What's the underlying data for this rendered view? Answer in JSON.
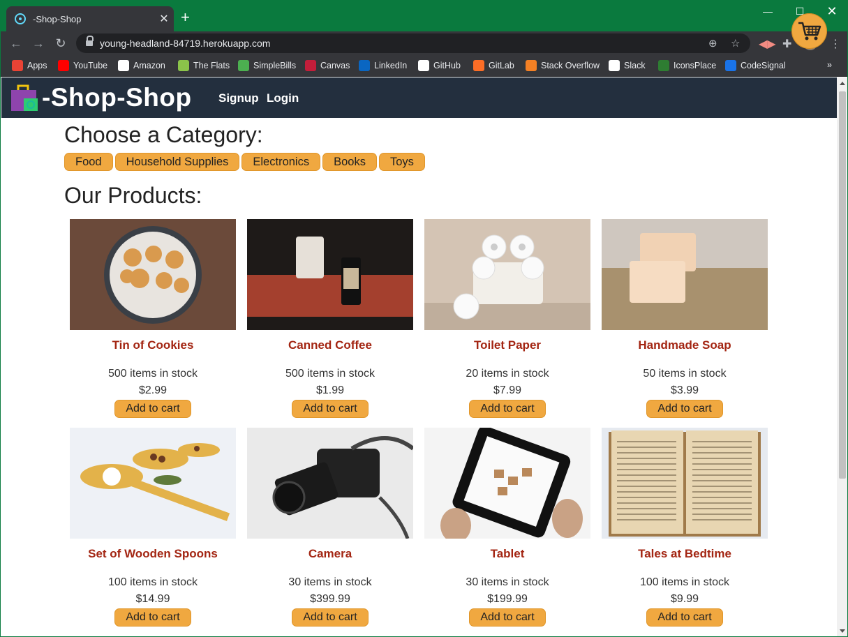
{
  "browser": {
    "tab_title": "-Shop-Shop",
    "url": "young-headland-84719.herokuapp.com",
    "bookmarks": [
      {
        "label": "Apps",
        "icon": "apps-grid-icon",
        "color": "#ea4335"
      },
      {
        "label": "YouTube",
        "icon": "youtube-icon",
        "color": "#ff0000"
      },
      {
        "label": "Amazon",
        "icon": "amazon-icon",
        "color": "#ffffff"
      },
      {
        "label": "The Flats",
        "icon": "building-icon",
        "color": "#8bc34a"
      },
      {
        "label": "SimpleBills",
        "icon": "leaf-icon",
        "color": "#4caf50"
      },
      {
        "label": "Canvas",
        "icon": "canvas-icon",
        "color": "#c41e3a"
      },
      {
        "label": "LinkedIn",
        "icon": "linkedin-icon",
        "color": "#0a66c2"
      },
      {
        "label": "GitHub",
        "icon": "github-icon",
        "color": "#ffffff"
      },
      {
        "label": "GitLab",
        "icon": "gitlab-icon",
        "color": "#fc6d26"
      },
      {
        "label": "Stack Overflow",
        "icon": "stackoverflow-icon",
        "color": "#f48024"
      },
      {
        "label": "Slack",
        "icon": "slack-icon",
        "color": "#ffffff"
      },
      {
        "label": "IconsPlace",
        "icon": "iconsplace-icon",
        "color": "#2e7d32"
      },
      {
        "label": "CodeSignal",
        "icon": "codesignal-icon",
        "color": "#1a73e8"
      }
    ]
  },
  "site": {
    "brand": "-Shop-Shop",
    "nav": {
      "signup": "Signup",
      "login": "Login"
    },
    "category_heading": "Choose a Category:",
    "categories": [
      "Food",
      "Household Supplies",
      "Electronics",
      "Books",
      "Toys"
    ],
    "products_heading": "Our Products:",
    "add_label": "Add to cart",
    "products": [
      {
        "name": "Tin of Cookies",
        "stock": "500 items in stock",
        "price": "$2.99",
        "image": "cookies-image"
      },
      {
        "name": "Canned Coffee",
        "stock": "500 items in stock",
        "price": "$1.99",
        "image": "coffee-image"
      },
      {
        "name": "Toilet Paper",
        "stock": "20 items in stock",
        "price": "$7.99",
        "image": "toilet-paper-image"
      },
      {
        "name": "Handmade Soap",
        "stock": "50 items in stock",
        "price": "$3.99",
        "image": "soap-image"
      },
      {
        "name": "Set of Wooden Spoons",
        "stock": "100 items in stock",
        "price": "$14.99",
        "image": "spoons-image"
      },
      {
        "name": "Camera",
        "stock": "30 items in stock",
        "price": "$399.99",
        "image": "camera-image"
      },
      {
        "name": "Tablet",
        "stock": "30 items in stock",
        "price": "$199.99",
        "image": "tablet-image"
      },
      {
        "name": "Tales at Bedtime",
        "stock": "100 items in stock",
        "price": "$9.99",
        "image": "book-image"
      }
    ]
  },
  "colors": {
    "header": "#232f3e",
    "accent": "#f0a840",
    "product_name": "#a32512",
    "chrome": "#0a7a3e"
  }
}
